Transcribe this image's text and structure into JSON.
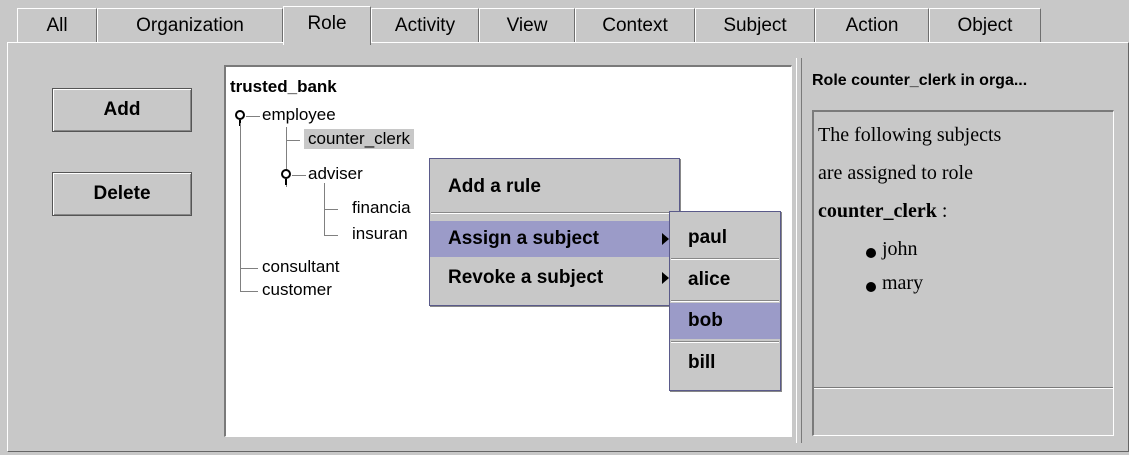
{
  "tabs": [
    "All",
    "Organization",
    "Role",
    "Activity",
    "View",
    "Context",
    "Subject",
    "Action",
    "Object"
  ],
  "active_tab": "Role",
  "buttons": {
    "add": "Add",
    "delete": "Delete"
  },
  "tree": {
    "root": "trusted_bank",
    "employee": "employee",
    "counter_clerk": "counter_clerk",
    "adviser": "adviser",
    "financial": "financia",
    "insurance": "insuran",
    "consultant": "consultant",
    "customer": "customer"
  },
  "info": {
    "title": "Role counter_clerk in orga...",
    "line1": "The following subjects",
    "line2": "are assigned to role",
    "role": "counter_clerk",
    "colon": " :",
    "subjects": [
      "john",
      "mary"
    ]
  },
  "context_menu": {
    "add_rule": "Add a rule",
    "assign": "Assign a subject",
    "revoke": "Revoke a subject"
  },
  "submenu": [
    "paul",
    "alice",
    "bob",
    "bill"
  ],
  "submenu_selected": "bob",
  "colors": {
    "selection": "#9b9bc8",
    "background": "#c8c8c8"
  }
}
